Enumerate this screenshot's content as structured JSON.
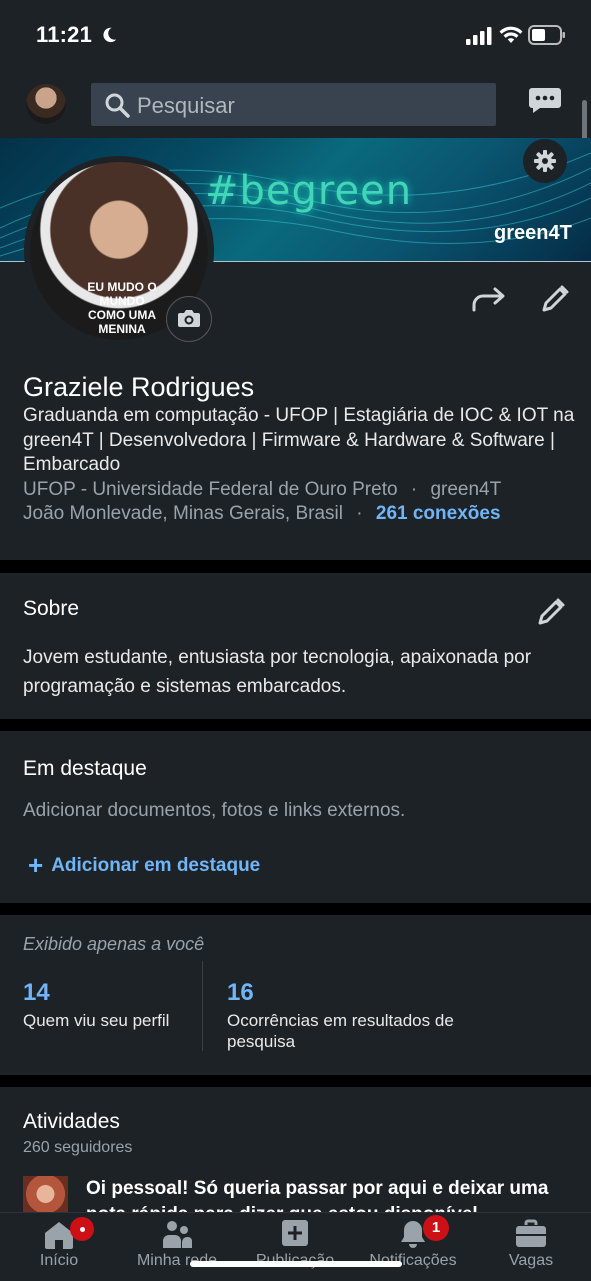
{
  "status_bar": {
    "time": "11:21"
  },
  "header": {
    "search_placeholder": "Pesquisar"
  },
  "cover": {
    "hashtag": "#begreen",
    "brand": "green4T"
  },
  "profile": {
    "shirt_text": "EU MUDO O MUNDO COMO UMA MENINA",
    "name": "Graziele Rodrigues",
    "headline": "Graduanda em computação - UFOP | Estagiária de IOC & IOT na green4T | Desenvolvedora | Firmware & Hardware & Software | Embarcado",
    "education": "UFOP - Universidade Federal de Ouro Preto",
    "company": "green4T",
    "location": "João Monlevade, Minas Gerais, Brasil",
    "separator": "·",
    "connections": "261 conexões"
  },
  "about": {
    "title": "Sobre",
    "text": "Jovem estudante, entusiasta por tecnologia, apaixonada por programação e sistemas embarcados."
  },
  "featured": {
    "title": "Em destaque",
    "description": "Adicionar documentos, fotos e links externos.",
    "add_label": "Adicionar em destaque"
  },
  "analytics": {
    "note": "Exibido apenas a você",
    "stats": [
      {
        "value": "14",
        "label": "Quem viu seu perfil"
      },
      {
        "value": "16",
        "label": "Ocorrências em resultados de pesquisa"
      }
    ]
  },
  "activity": {
    "title": "Atividades",
    "followers": "260 seguidores",
    "post_text": "Oi pessoal! Só queria passar por aqui e deixar uma nota rápida para dizer que estou disponível"
  },
  "bottom_nav": {
    "items": [
      {
        "label": "Início",
        "icon": "home-icon"
      },
      {
        "label": "Minha rede",
        "icon": "network-icon"
      },
      {
        "label": "Publicação",
        "icon": "post-icon"
      },
      {
        "label": "Notificações",
        "icon": "bell-icon",
        "badge": "1"
      },
      {
        "label": "Vagas",
        "icon": "briefcase-icon"
      }
    ]
  },
  "colors": {
    "background": "#1d2226",
    "accent": "#70b5f9",
    "badge": "#cc1016"
  }
}
